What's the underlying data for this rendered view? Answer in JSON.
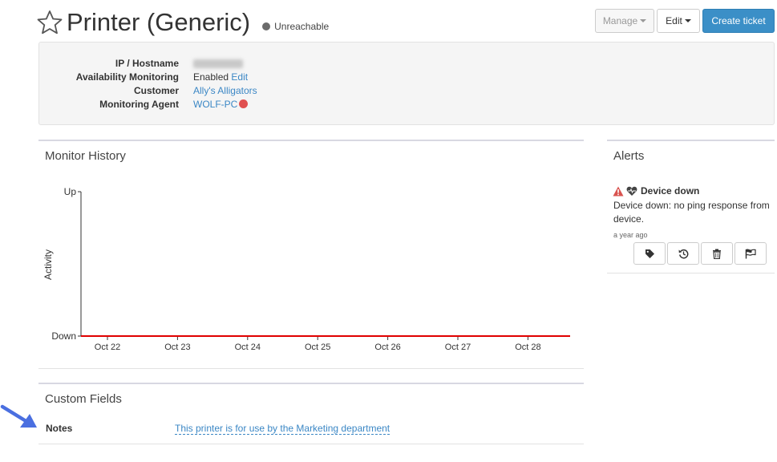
{
  "header": {
    "title": "Printer (Generic)",
    "status": "Unreachable",
    "star_icon": "star-outline-icon",
    "status_color": "#6b6b6b"
  },
  "toolbar": {
    "manage_label": "Manage",
    "edit_label": "Edit",
    "create_ticket_label": "Create ticket"
  },
  "info": {
    "ip_label": "IP / Hostname",
    "availability_label": "Availability Monitoring",
    "availability_value": "Enabled",
    "availability_edit": "Edit",
    "customer_label": "Customer",
    "customer_value": "Ally's Alligators",
    "agent_label": "Monitoring Agent",
    "agent_value": "WOLF-PC",
    "agent_status_color": "#e05050"
  },
  "monitor_history": {
    "title": "Monitor History"
  },
  "chart_data": {
    "type": "line",
    "categories": [
      "Oct 22",
      "Oct 23",
      "Oct 24",
      "Oct 25",
      "Oct 26",
      "Oct 27",
      "Oct 28"
    ],
    "y_categories": [
      "Down",
      "Up"
    ],
    "ylabel": "Activity",
    "series": [
      {
        "values": [
          0,
          0,
          0,
          0,
          0,
          0,
          0
        ],
        "color": "#e00000"
      }
    ]
  },
  "alerts": {
    "title": "Alerts",
    "items": [
      {
        "title": "Device down",
        "description": "Device down: no ping response from device.",
        "time": "a year ago",
        "warning_color": "#d9534f"
      }
    ],
    "actions": [
      "tag-icon",
      "history-icon",
      "trash-icon",
      "flag-icon"
    ]
  },
  "custom_fields": {
    "title": "Custom Fields",
    "notes_label": "Notes",
    "notes_value": "This printer is for use by the Marketing department"
  },
  "annotation": {
    "arrow_color": "#4a6fe0"
  }
}
